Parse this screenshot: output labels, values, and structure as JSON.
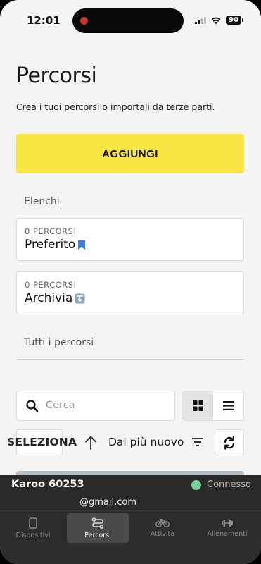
{
  "status_bar": {
    "time": "12:01",
    "battery": "90"
  },
  "header": {
    "title": "Percorsi",
    "subtitle": "Crea i tuoi percorsi o importali da terze parti."
  },
  "add_button": {
    "label": "AGGIUNGI"
  },
  "lists_section": {
    "label": "Elenchi",
    "items": [
      {
        "count": "0 PERCORSI",
        "name": "Preferito",
        "icon": "bookmark-icon",
        "icon_color": "#3d7ee6"
      },
      {
        "count": "0 PERCORSI",
        "name": "Archivia",
        "icon": "archive-icon",
        "icon_color": "#8a9fb5"
      }
    ]
  },
  "all_routes": {
    "label": "Tutti i percorsi"
  },
  "search": {
    "placeholder": "Cerca",
    "value": ""
  },
  "toolbar": {
    "select_label": "SELEZIONA",
    "sort_label": "Dal più nuovo"
  },
  "device": {
    "name": "Karoo 60253",
    "status": "Connesso",
    "status_color": "#7fd59a",
    "email": "@gmail.com"
  },
  "tabs": [
    {
      "label": "Dispositivi",
      "icon": "device-icon",
      "active": false
    },
    {
      "label": "Percorsi",
      "icon": "route-icon",
      "active": true
    },
    {
      "label": "Attività",
      "icon": "bike-icon",
      "active": false
    },
    {
      "label": "Allenamenti",
      "icon": "dumbbell-icon",
      "active": false
    }
  ],
  "colors": {
    "accent_yellow": "#f8e443",
    "background": "#f4f4f4"
  }
}
